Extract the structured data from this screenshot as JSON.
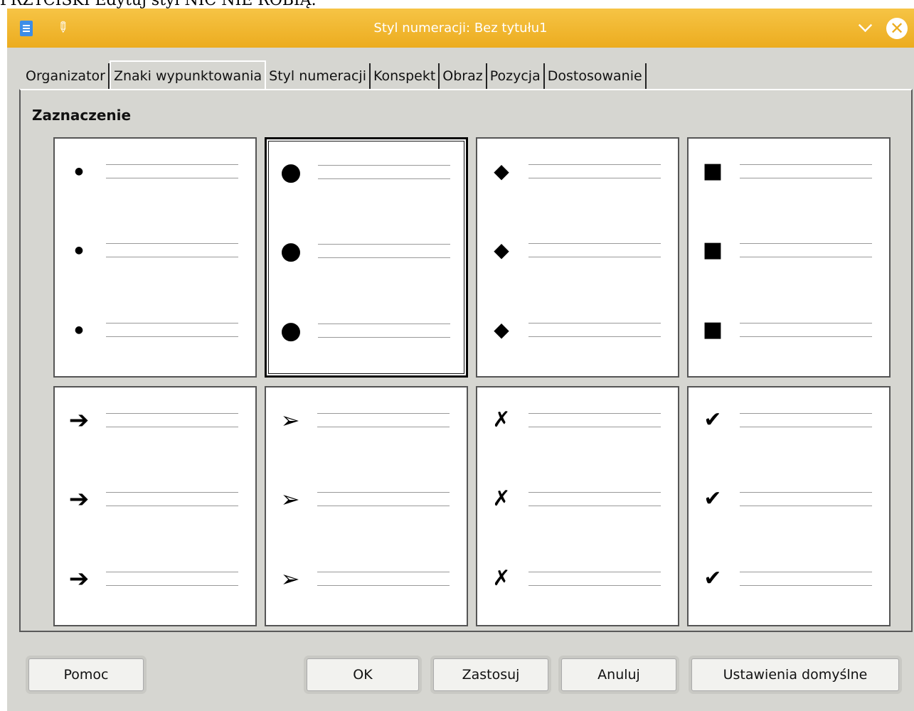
{
  "caption": "PRZYCISKI Edytuj styl NIC NIE ROBIĄ.",
  "dialog": {
    "title": "Styl numeracji: Bez tytułu1",
    "tabs": [
      {
        "label": "Organizator"
      },
      {
        "label": "Znaki wypunktowania",
        "active": true
      },
      {
        "label": "Styl numeracji"
      },
      {
        "label": "Konspekt"
      },
      {
        "label": "Obraz"
      },
      {
        "label": "Pozycja"
      },
      {
        "label": "Dostosowanie"
      }
    ],
    "section_label": "Zaznaczenie",
    "bullet_styles": [
      {
        "name": "small-dot",
        "glyph": "●",
        "selected": false
      },
      {
        "name": "large-dot",
        "glyph": "●",
        "selected": true
      },
      {
        "name": "diamond",
        "glyph": "◆",
        "selected": false
      },
      {
        "name": "square",
        "glyph": "■",
        "selected": false
      },
      {
        "name": "arrow",
        "glyph": "➔",
        "selected": false
      },
      {
        "name": "arrowhead",
        "glyph": "➢",
        "selected": false
      },
      {
        "name": "cross",
        "glyph": "✗",
        "selected": false
      },
      {
        "name": "checkmark",
        "glyph": "✔",
        "selected": false
      }
    ],
    "buttons": {
      "help": "Pomoc",
      "ok": "OK",
      "apply": "Zastosuj",
      "cancel": "Anuluj",
      "defaults": "Ustawienia domyślne"
    }
  }
}
